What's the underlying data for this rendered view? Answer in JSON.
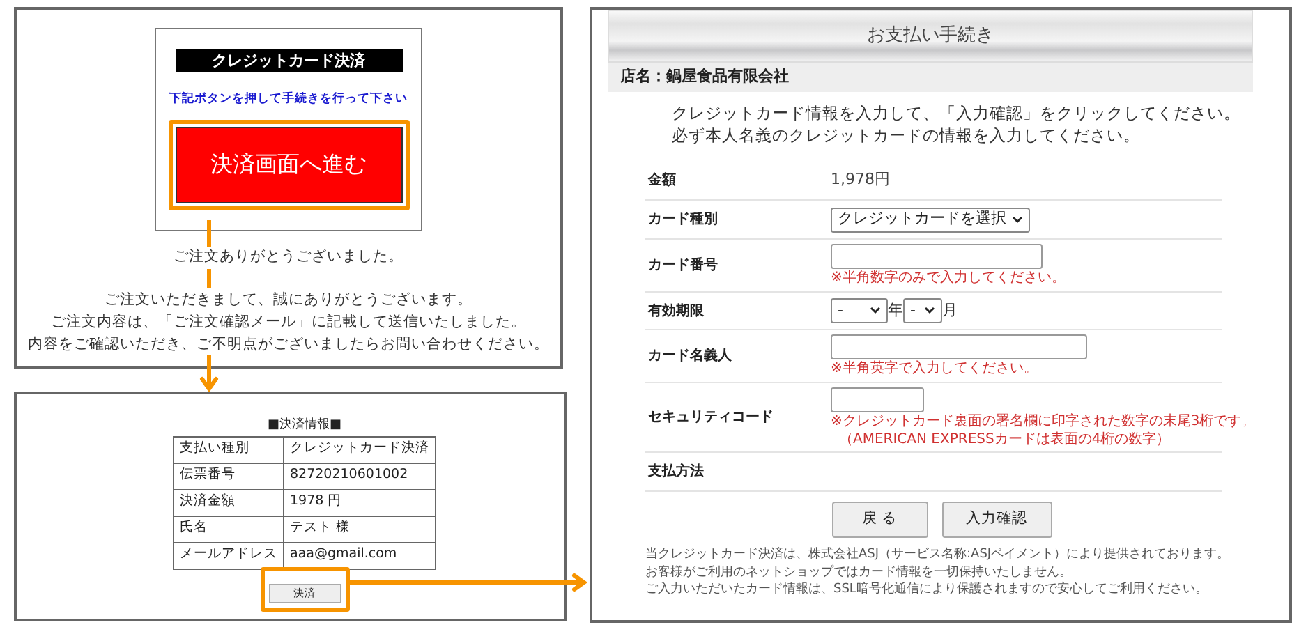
{
  "order_complete": {
    "payment_box": {
      "title": "クレジットカード決済",
      "instruction": "下記ボタンを押して手続きを行って下さい",
      "button": {
        "label": "決済画面へ進む",
        "highlighted": true
      }
    },
    "thanks": "ご注文ありがとうございました。",
    "messages": [
      "ご注文いただきまして、誠にありがとうございます。",
      "ご注文内容は、「ご注文確認メール」に記載して送信いたしました。",
      "内容をご確認いただき、ご不明点がございましたらお問い合わせください。"
    ]
  },
  "payment_info": {
    "title": "■決済情報■",
    "rows": [
      {
        "label": "支払い種別",
        "value": "クレジットカード決済"
      },
      {
        "label": "伝票番号",
        "value": "82720210601002"
      },
      {
        "label": "決済金額",
        "value": "1978 円"
      },
      {
        "label": "氏名",
        "value": "テスト 様"
      },
      {
        "label": "メールアドレス",
        "value": "aaa@gmail.com"
      }
    ],
    "button": {
      "label": "決済",
      "highlighted": true
    }
  },
  "payment_form": {
    "title": "お支払い手続き",
    "store": "店名：鍋屋食品有限会社",
    "intro": [
      "クレジットカード情報を入力して、「入力確認」をクリックしてください。",
      "必ず本人名義のクレジットカードの情報を入力してください。"
    ],
    "fields": [
      {
        "kind": "text",
        "label": "金額",
        "value": "1,978円"
      },
      {
        "kind": "select",
        "label": "カード種別",
        "value": "クレジットカードを選択"
      },
      {
        "kind": "input",
        "label": "カード番号",
        "notes": [
          "※半角数字のみで入力してください。"
        ]
      },
      {
        "kind": "expiry",
        "label": "有効期限",
        "year": "-",
        "year_unit": "年",
        "month": "-",
        "month_unit": "月"
      },
      {
        "kind": "wideinput",
        "label": "カード名義人",
        "notes": [
          "※半角英字で入力してください。"
        ]
      },
      {
        "kind": "shortinput",
        "label": "セキュリティコード",
        "notes": [
          "※クレジットカード裏面の署名欄に印字された数字の末尾3桁です。",
          "（AMERICAN EXPRESSカードは表面の4桁の数字）"
        ]
      },
      {
        "kind": "empty",
        "label": "支払方法"
      }
    ],
    "buttons": [
      "戻 る",
      "入力確認"
    ],
    "footer": [
      "当クレジットカード決済は、株式会社ASJ（サービス名称:ASJペイメント）により提供されております。",
      "お客様がご利用のネットショップではカード情報を一切保持いたしません。",
      "ご入力いただいたカード情報は、SSL暗号化通信により保護されますので安心してご利用ください。"
    ]
  }
}
